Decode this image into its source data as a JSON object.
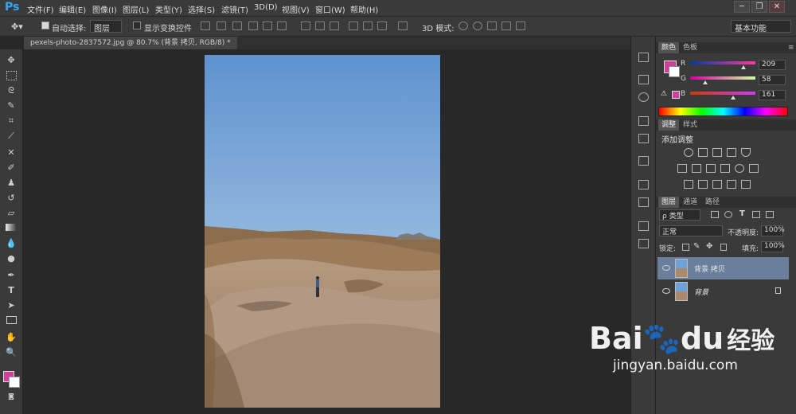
{
  "app": {
    "logo": "Ps"
  },
  "menu": [
    "文件(F)",
    "编辑(E)",
    "图像(I)",
    "图层(L)",
    "类型(Y)",
    "选择(S)",
    "滤镜(T)",
    "3D(D)",
    "视图(V)",
    "窗口(W)",
    "帮助(H)"
  ],
  "window_buttons": [
    "─",
    "❐",
    "✕"
  ],
  "options": {
    "auto_select_label": "自动选择:",
    "auto_select_value": "图层",
    "show_transform_label": "显示变换控件",
    "mode_3d_label": "3D 模式:",
    "workspace": "基本功能"
  },
  "document": {
    "tab_title": "pexels-photo-2837572.jpg @ 80.7% (背景 拷贝, RGB/8) *"
  },
  "color_panel": {
    "tabs": [
      "颜色",
      "色板"
    ],
    "foreground": "#d13f9c",
    "channels": [
      {
        "label": "R",
        "value": "209"
      },
      {
        "label": "G",
        "value": "58"
      },
      {
        "label": "B",
        "value": "161"
      }
    ]
  },
  "adjustments_panel": {
    "tabs": [
      "调整",
      "样式"
    ],
    "title": "添加调整"
  },
  "layers_panel": {
    "tabs": [
      "图层",
      "通道",
      "路径"
    ],
    "filter": "ρ 类型",
    "blend_mode": "正常",
    "opacity_label": "不透明度:",
    "opacity_value": "100%",
    "lock_label": "锁定:",
    "fill_label": "填充:",
    "fill_value": "100%",
    "layers": [
      {
        "name": "背景 拷贝",
        "selected": true,
        "locked": false
      },
      {
        "name": "背景",
        "selected": false,
        "locked": true
      }
    ]
  },
  "watermark": {
    "brand_latin": "Bai",
    "brand_paw": "du",
    "brand_cn": "经验",
    "url": "jingyan.baidu.com"
  }
}
